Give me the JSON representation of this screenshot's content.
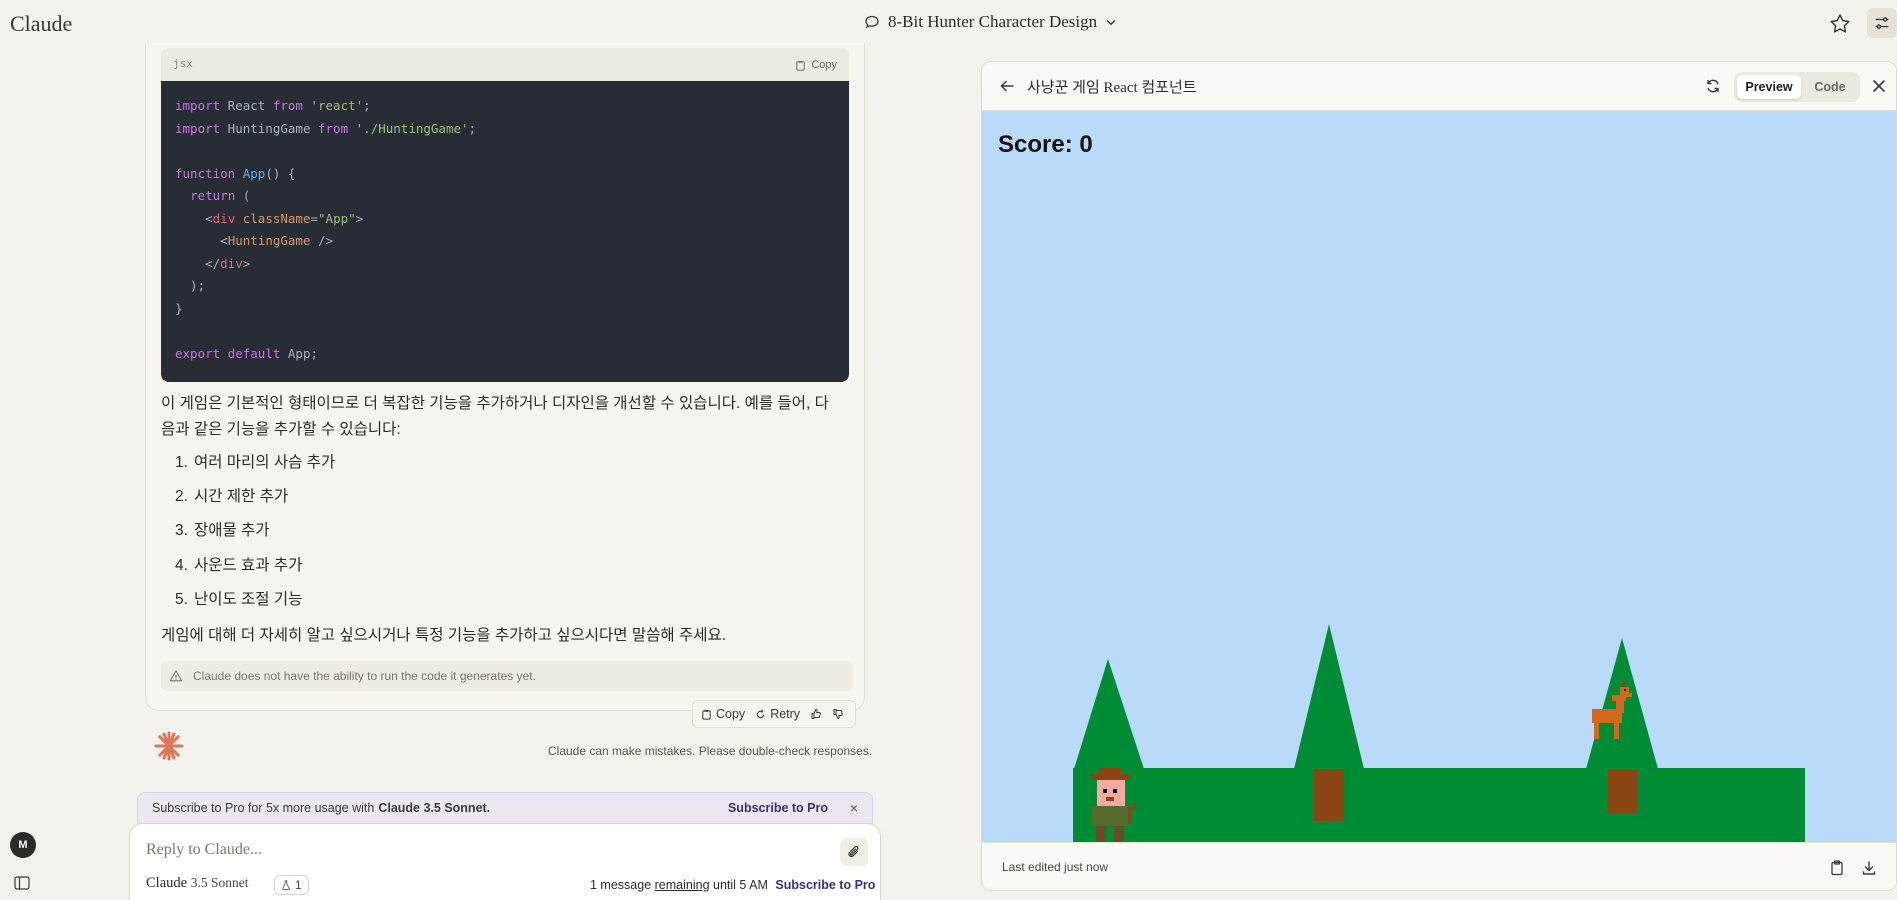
{
  "app": {
    "brand": "Claude"
  },
  "header": {
    "conversation_title": "8-Bit Hunter Character Design"
  },
  "code": {
    "lang": "jsx",
    "copy_label": "Copy",
    "lines": [
      [
        [
          "kw",
          "import"
        ],
        [
          "pl",
          " React "
        ],
        [
          "kw",
          "from"
        ],
        [
          "pl",
          " "
        ],
        [
          "str",
          "'react'"
        ],
        [
          "pl",
          ";"
        ]
      ],
      [
        [
          "kw",
          "import"
        ],
        [
          "pl",
          " HuntingGame "
        ],
        [
          "kw",
          "from"
        ],
        [
          "pl",
          " "
        ],
        [
          "str",
          "'./HuntingGame'"
        ],
        [
          "pl",
          ";"
        ]
      ],
      [],
      [
        [
          "kw",
          "function"
        ],
        [
          "pl",
          " "
        ],
        [
          "fn",
          "App"
        ],
        [
          "pl",
          "() {"
        ]
      ],
      [
        [
          "pl",
          "  "
        ],
        [
          "kw",
          "return"
        ],
        [
          "pl",
          " ("
        ]
      ],
      [
        [
          "pl",
          "    <"
        ],
        [
          "tag",
          "div"
        ],
        [
          "pl",
          " "
        ],
        [
          "attr",
          "className"
        ],
        [
          "pl",
          "="
        ],
        [
          "str",
          "\"App\""
        ],
        [
          "pl",
          ">"
        ]
      ],
      [
        [
          "pl",
          "      <"
        ],
        [
          "attr",
          "HuntingGame"
        ],
        [
          "pl",
          " />"
        ]
      ],
      [
        [
          "pl",
          "    </"
        ],
        [
          "tag",
          "div"
        ],
        [
          "pl",
          ">"
        ]
      ],
      [
        [
          "pl",
          "  );"
        ]
      ],
      [
        [
          "pl",
          "}"
        ]
      ],
      [],
      [
        [
          "kw",
          "export"
        ],
        [
          "pl",
          " "
        ],
        [
          "kw",
          "default"
        ],
        [
          "pl",
          " App;"
        ]
      ]
    ]
  },
  "message": {
    "intro": "이 게임은 기본적인 형태이므로 더 복잡한 기능을 추가하거나 디자인을 개선할 수 있습니다. 예를 들어, 다음과 같은 기능을 추가할 수 있습니다:",
    "list": [
      {
        "num": "1.",
        "text": "여러 마리의 사슴 추가"
      },
      {
        "num": "2.",
        "text": "시간 제한 추가"
      },
      {
        "num": "3.",
        "text": "장애물 추가"
      },
      {
        "num": "4.",
        "text": "사운드 효과 추가"
      },
      {
        "num": "5.",
        "text": "난이도 조절 기능"
      }
    ],
    "outro": "게임에 대해 더 자세히 알고 싶으시거나 특정 기능을 추가하고 싶으시다면 말씀해 주세요.",
    "warning": "Claude does not have the ability to run the code it generates yet."
  },
  "actions": {
    "copy": "Copy",
    "retry": "Retry"
  },
  "disclaimer": "Claude can make mistakes. Please double-check responses.",
  "banner": {
    "text": "Subscribe to Pro for 5x more usage with",
    "model": "Claude 3.5 Sonnet.",
    "cta": "Subscribe to Pro",
    "close": "×"
  },
  "composer": {
    "placeholder": "Reply to Claude...",
    "model_name": "Claude",
    "model_version": "3.5 Sonnet",
    "project_count": "1",
    "remaining_pre": "1 message",
    "remaining_u": "remaining",
    "remaining_post": "until 5 AM",
    "cta": "Subscribe to Pro"
  },
  "user": {
    "initial": "M"
  },
  "artifact": {
    "title": "사냥꾼 게임 React 컴포넌트",
    "tab_preview": "Preview",
    "tab_code": "Code",
    "score_label": "Score: 0",
    "footer": "Last edited just now"
  },
  "colors": {
    "sky": "#b9daf9",
    "grass": "#008b35",
    "trunk": "#8b4513",
    "deer": "#d2691e",
    "accent": "#da7756"
  }
}
